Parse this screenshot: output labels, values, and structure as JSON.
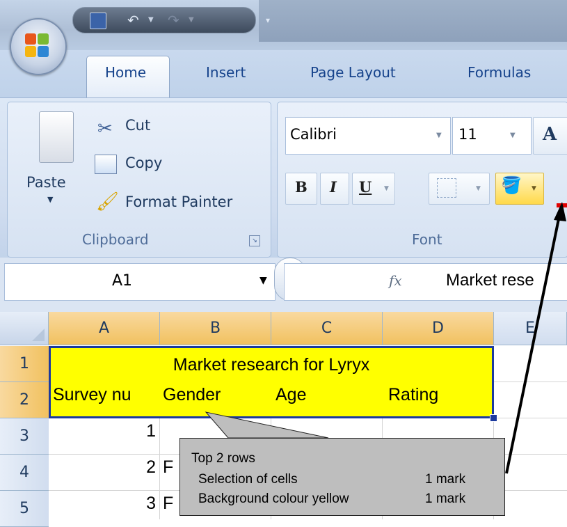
{
  "ribbon_tabs": [
    "Home",
    "Insert",
    "Page Layout",
    "Formulas"
  ],
  "clipboard": {
    "paste": "Paste",
    "cut": "Cut",
    "copy": "Copy",
    "format_painter": "Format Painter",
    "group_label": "Clipboard"
  },
  "font_group": {
    "font_name": "Calibri",
    "font_size": "11",
    "bold": "B",
    "italic": "I",
    "underline": "U",
    "group_label": "Font",
    "grow_font": "A"
  },
  "formula_bar": {
    "name_box": "A1",
    "fx": "fx",
    "content": "Market rese"
  },
  "columns": [
    "A",
    "B",
    "C",
    "D",
    "E"
  ],
  "rows": [
    "1",
    "2",
    "3",
    "4",
    "5"
  ],
  "cells": {
    "r1_title": "Market research for Lyryx",
    "r2": [
      "Survey nu",
      "Gender",
      "Age",
      "Rating"
    ],
    "r3_a": "1",
    "r4_a": "2",
    "r4_b": "F",
    "r5_a": "3",
    "r5_b": "F"
  },
  "callout": {
    "title": "Top 2 rows",
    "line1_label": "Selection of cells",
    "line1_mark": "1 mark",
    "line2_label": "Background colour yellow",
    "line2_mark": "1 mark"
  },
  "colors": {
    "selection_fill": "#ffff00",
    "selection_border": "#1c3a9e",
    "header_selected": "#f1c15f",
    "callout_fill": "#bebebe"
  }
}
